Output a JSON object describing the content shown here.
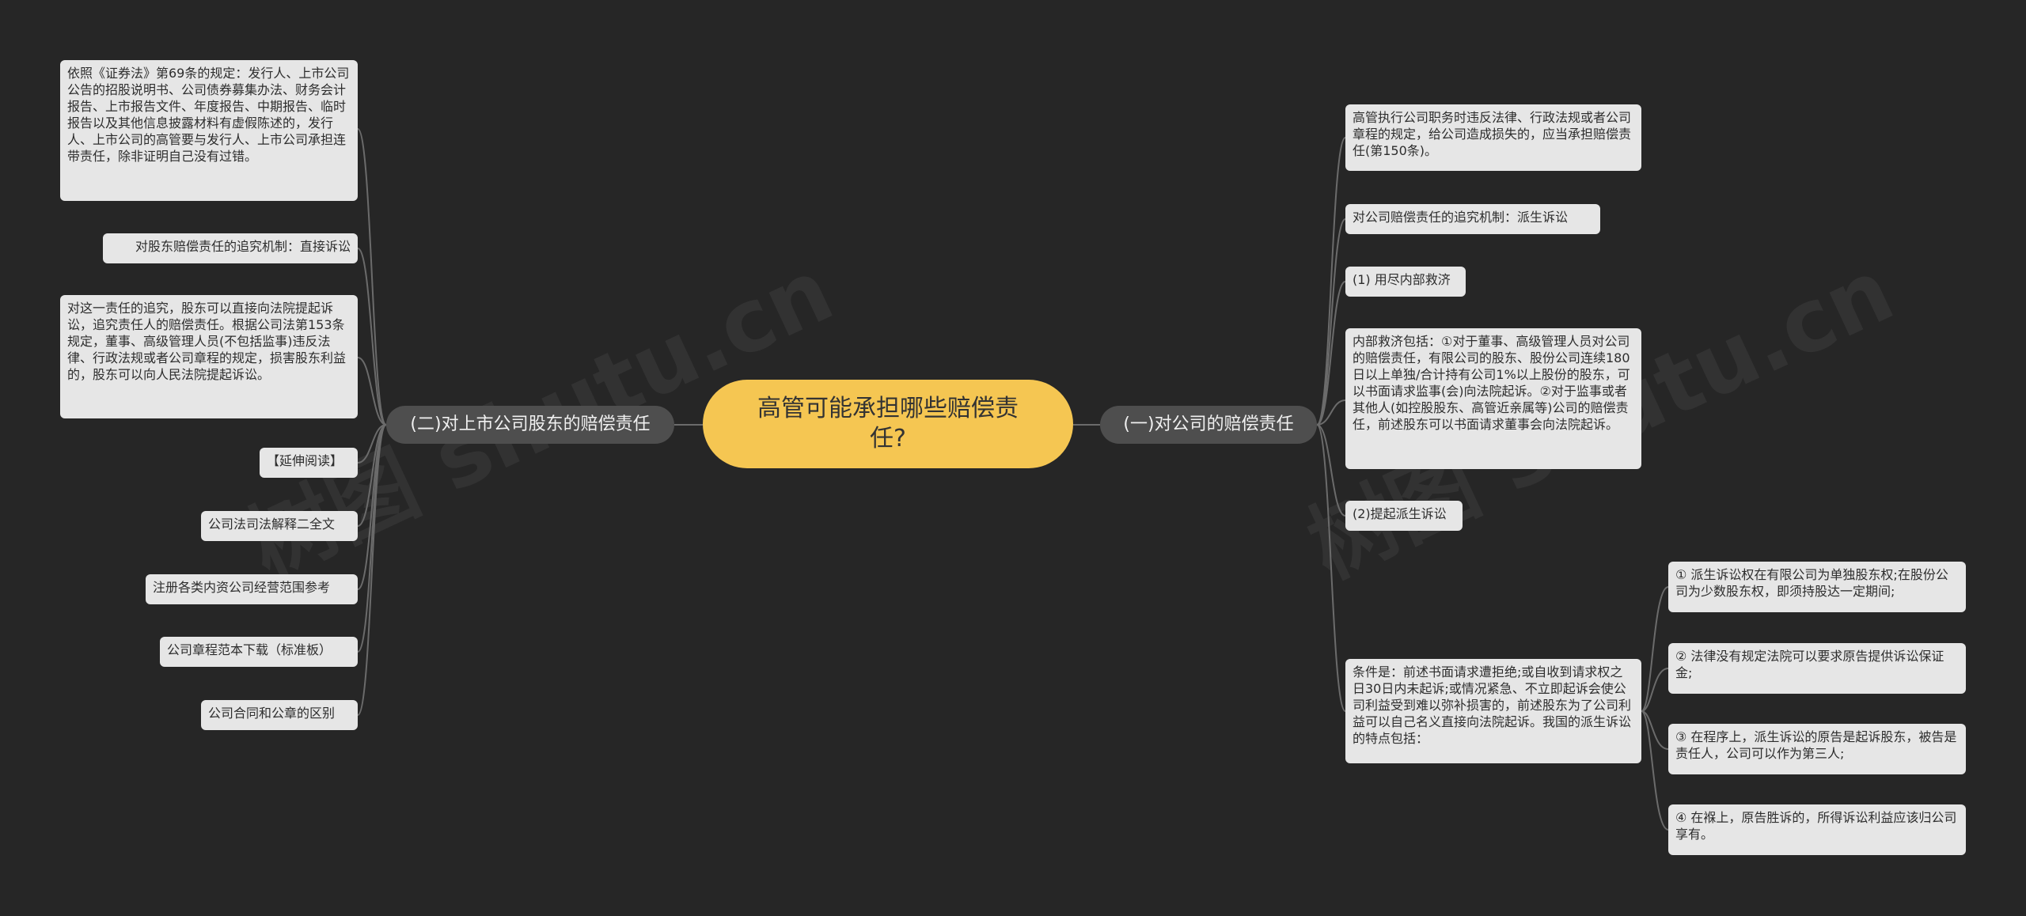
{
  "root": {
    "title": "高管可能承担哪些赔偿责任?"
  },
  "watermark": {
    "left": "树图 shutu.cn",
    "right": "树图 shutu.cn"
  },
  "left": {
    "label": "(二)对上市公司股东的赔偿责任",
    "items": [
      "依照《证券法》第69条的规定：发行人、上市公司公告的招股说明书、公司债券募集办法、财务会计报告、上市报告文件、年度报告、中期报告、临时报告以及其他信息披露材料有虚假陈述的，发行人、上市公司的高管要与发行人、上市公司承担连带责任，除非证明自己没有过错。",
      "对股东赔偿责任的追究机制：直接诉讼",
      "对这一责任的追究，股东可以直接向法院提起诉讼，追究责任人的赔偿责任。根据公司法第153条规定，董事、高级管理人员(不包括监事)违反法律、行政法规或者公司章程的规定，损害股东利益的，股东可以向人民法院提起诉讼。",
      "【延伸阅读】",
      "公司法司法解释二全文",
      "注册各类内资公司经营范围参考",
      "公司章程范本下载（标准板）",
      "公司合同和公章的区别"
    ]
  },
  "right": {
    "label": "(一)对公司的赔偿责任",
    "items": [
      "高管执行公司职务时违反法律、行政法规或者公司章程的规定，给公司造成损失的，应当承担赔偿责任(第150条)。",
      "对公司赔偿责任的追究机制：派生诉讼",
      "(1) 用尽内部救济",
      "内部救济包括：①对于董事、高级管理人员对公司的赔偿责任，有限公司的股东、股份公司连续180日以上单独/合计持有公司1%以上股份的股东，可以书面请求监事(会)向法院起诉。②对于监事或者其他人(如控股股东、高管近亲属等)公司的赔偿责任，前述股东可以书面请求董事会向法院起诉。",
      "(2)提起派生诉讼",
      "条件是：前述书面请求遭拒绝;或自收到请求权之日30日内未起诉;或情况紧急、不立即起诉会使公司利益受到难以弥补损害的，前述股东为了公司利益可以自己名义直接向法院起诉。我国的派生诉讼的特点包括："
    ],
    "features": [
      "① 派生诉讼权在有限公司为单独股东权;在股份公司为少数股东权，即须持股达一定期间;",
      "② 法律没有规定法院可以要求原告提供诉讼保证金;",
      "③ 在程序上，派生诉讼的原告是起诉股东，被告是责任人，公司可以作为第三人;",
      "④ 在褓上，原告胜诉的，所得诉讼利益应该归公司享有。"
    ]
  }
}
